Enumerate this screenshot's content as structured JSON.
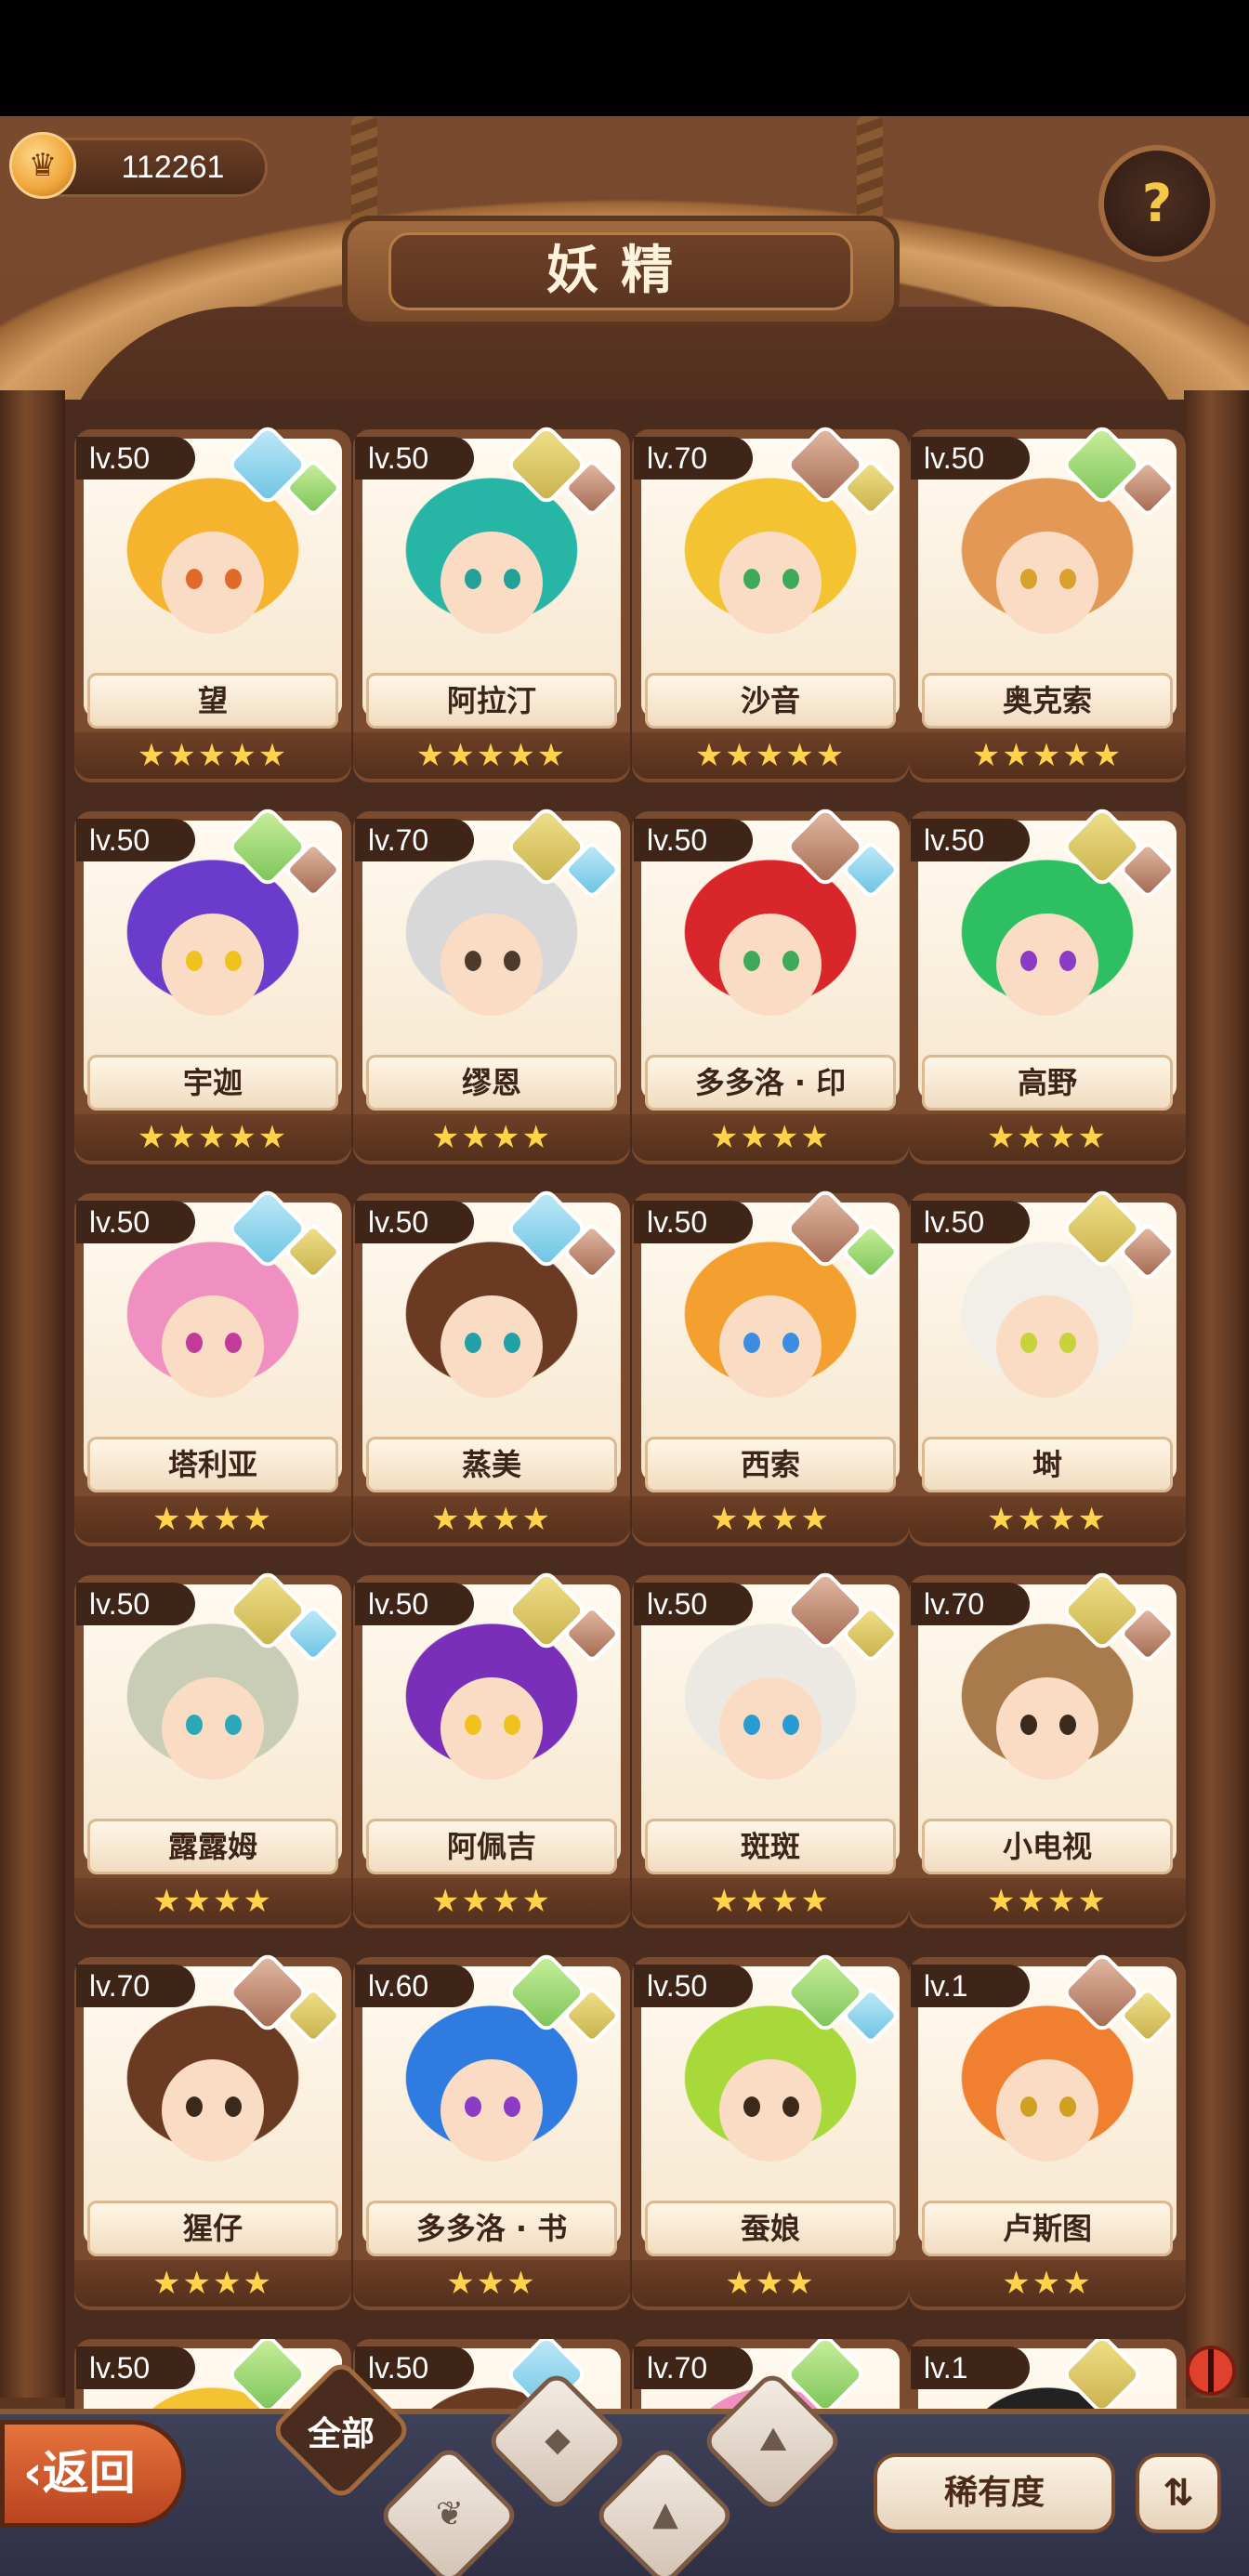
{
  "currency": {
    "amount": "112261",
    "icon": "acorn-coin-icon"
  },
  "title": "妖精",
  "help_icon": "question-sprout-icon",
  "colors": {
    "accent": "#7a4b2f",
    "star": "#ffd34a",
    "lv_tag": "#3e2518"
  },
  "fairies": [
    {
      "level": "lv.50",
      "name": "望",
      "stars": "★★★★★",
      "elements": [
        "water-icon",
        "leaf-icon"
      ],
      "hair": "#f5b32e",
      "eye": "#e06a2a"
    },
    {
      "level": "lv.50",
      "name": "阿拉汀",
      "stars": "★★★★★",
      "elements": [
        "earth-icon",
        "mountain-icon"
      ],
      "hair": "#27b6a6",
      "eye": "#24a09a"
    },
    {
      "level": "lv.70",
      "name": "沙音",
      "stars": "★★★★★",
      "elements": [
        "mountain-icon",
        "earth-icon"
      ],
      "hair": "#f3c331",
      "eye": "#3fa95a"
    },
    {
      "level": "lv.50",
      "name": "奥克索",
      "stars": "★★★★★",
      "elements": [
        "leaf-icon",
        "mountain-icon"
      ],
      "hair": "#e39856",
      "eye": "#d6a12c"
    },
    {
      "level": "lv.50",
      "name": "宇迦",
      "stars": "★★★★★",
      "elements": [
        "leaf-icon",
        "mountain-icon"
      ],
      "hair": "#6b3bcb",
      "eye": "#f0c21d"
    },
    {
      "level": "lv.70",
      "name": "缪恩",
      "stars": "★★★★",
      "elements": [
        "earth-icon",
        "water-icon"
      ],
      "hair": "#d8d8d8",
      "eye": "#4c3b2c"
    },
    {
      "level": "lv.50",
      "name": "多多洛 · 印",
      "stars": "★★★★",
      "elements": [
        "mountain-icon",
        "water-icon"
      ],
      "hair": "#d8262a",
      "eye": "#3fa95a"
    },
    {
      "level": "lv.50",
      "name": "高野",
      "stars": "★★★★",
      "elements": [
        "earth-icon",
        "mountain-icon"
      ],
      "hair": "#2fbf63",
      "eye": "#8b3bc4"
    },
    {
      "level": "lv.50",
      "name": "塔利亚",
      "stars": "★★★★",
      "elements": [
        "water-icon",
        "earth-icon"
      ],
      "hair": "#f090c0",
      "eye": "#c23a9a"
    },
    {
      "level": "lv.50",
      "name": "蒸美",
      "stars": "★★★★",
      "elements": [
        "water-icon",
        "mountain-icon"
      ],
      "hair": "#6a3b22",
      "eye": "#22a0a8"
    },
    {
      "level": "lv.50",
      "name": "西索",
      "stars": "★★★★",
      "elements": [
        "mountain-icon",
        "leaf-icon"
      ],
      "hair": "#f4a030",
      "eye": "#3a8de0"
    },
    {
      "level": "lv.50",
      "name": "埘",
      "stars": "★★★★",
      "elements": [
        "earth-icon",
        "mountain-icon"
      ],
      "hair": "#f1efe8",
      "eye": "#c8d23a"
    },
    {
      "level": "lv.50",
      "name": "露露姆",
      "stars": "★★★★",
      "elements": [
        "earth-icon",
        "water-icon"
      ],
      "hair": "#c9cdb6",
      "eye": "#2aa8b8"
    },
    {
      "level": "lv.50",
      "name": "阿佩吉",
      "stars": "★★★★",
      "elements": [
        "earth-icon",
        "mountain-icon"
      ],
      "hair": "#7a2fb8",
      "eye": "#f0c21d"
    },
    {
      "level": "lv.50",
      "name": "斑斑",
      "stars": "★★★★",
      "elements": [
        "mountain-icon",
        "earth-icon"
      ],
      "hair": "#ece8e2",
      "eye": "#2a9bd0"
    },
    {
      "level": "lv.70",
      "name": "小电视",
      "stars": "★★★★",
      "elements": [
        "earth-icon",
        "mountain-icon"
      ],
      "hair": "#a97a4b",
      "eye": "#3b2a1c"
    },
    {
      "level": "lv.70",
      "name": "猩仔",
      "stars": "★★★★",
      "elements": [
        "mountain-icon",
        "earth-icon"
      ],
      "hair": "#6a3b22",
      "eye": "#3b2a1c"
    },
    {
      "level": "lv.60",
      "name": "多多洛 · 书",
      "stars": "★★★",
      "elements": [
        "leaf-icon",
        "earth-icon"
      ],
      "hair": "#2f7be0",
      "eye": "#8b3bc4"
    },
    {
      "level": "lv.50",
      "name": "蚕娘",
      "stars": "★★★",
      "elements": [
        "leaf-icon",
        "water-icon"
      ],
      "hair": "#a7d93a",
      "eye": "#3b2a1c"
    },
    {
      "level": "lv.1",
      "name": "卢斯图",
      "stars": "★★★",
      "elements": [
        "mountain-icon",
        "earth-icon"
      ],
      "hair": "#f08030",
      "eye": "#d0a020"
    },
    {
      "level": "lv.50",
      "name": "",
      "stars": "",
      "elements": [
        "leaf-icon"
      ],
      "hair": "#f3c331",
      "eye": "#3b2a1c"
    },
    {
      "level": "lv.50",
      "name": "",
      "stars": "",
      "elements": [
        "water-icon"
      ],
      "hair": "#6a3b22",
      "eye": "#3b2a1c"
    },
    {
      "level": "lv.70",
      "name": "",
      "stars": "",
      "elements": [
        "leaf-icon"
      ],
      "hair": "#f090c0",
      "eye": "#3b2a1c"
    },
    {
      "level": "lv.1",
      "name": "",
      "stars": "",
      "elements": [
        "earth-icon"
      ],
      "hair": "#222222",
      "eye": "#3b2a1c"
    }
  ],
  "bottom": {
    "back_label": "返回",
    "back_icon": "chevron-left-icon",
    "filter_all_label": "全部",
    "filters": [
      "sprout-filter-icon",
      "water-filter-icon",
      "mountain-filter-icon",
      "snowpeak-filter-icon"
    ],
    "sort_label": "稀有度",
    "order_icon": "sort-order-icon"
  }
}
